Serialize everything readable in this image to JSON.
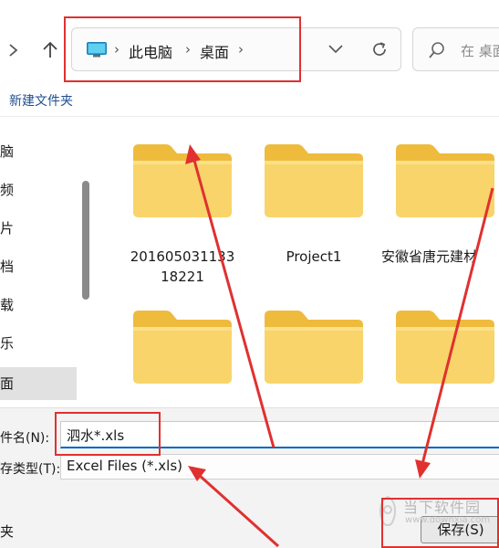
{
  "address_bar": {
    "crumbs": [
      "此电脑",
      "桌面"
    ]
  },
  "search": {
    "placeholder": "在 桌面"
  },
  "toolbar": {
    "new_folder_label": "新建文件夹"
  },
  "sidebar": {
    "items": [
      {
        "label": "脑",
        "selected": false
      },
      {
        "label": "频",
        "selected": false
      },
      {
        "label": "片",
        "selected": false
      },
      {
        "label": "档",
        "selected": false
      },
      {
        "label": "载",
        "selected": false
      },
      {
        "label": "乐",
        "selected": false
      },
      {
        "label": "面",
        "selected": true
      }
    ]
  },
  "folders": [
    {
      "name_line1": "201605031133",
      "name_line2": "18221"
    },
    {
      "name_line1": "Project1",
      "name_line2": ""
    },
    {
      "name_line1": "安徽省唐元建材",
      "name_line2": ""
    },
    {
      "name_line1": "",
      "name_line2": ""
    },
    {
      "name_line1": "",
      "name_line2": ""
    },
    {
      "name_line1": "",
      "name_line2": ""
    }
  ],
  "form": {
    "filename_label": "件名(N):",
    "filename_value": "泗水*.xls",
    "filetype_label": "存类型(T):",
    "filetype_value": "Excel Files (*.xls)",
    "hide_folders_label": "夹",
    "save_label": "保存(S)"
  },
  "watermark": {
    "text": "当下软件园",
    "url": "www.downxia.com"
  },
  "colors": {
    "accent": "#0067c0",
    "annotation_red": "#e0312f",
    "folder_body": "#f8d46a",
    "folder_tab": "#efbb3d"
  }
}
